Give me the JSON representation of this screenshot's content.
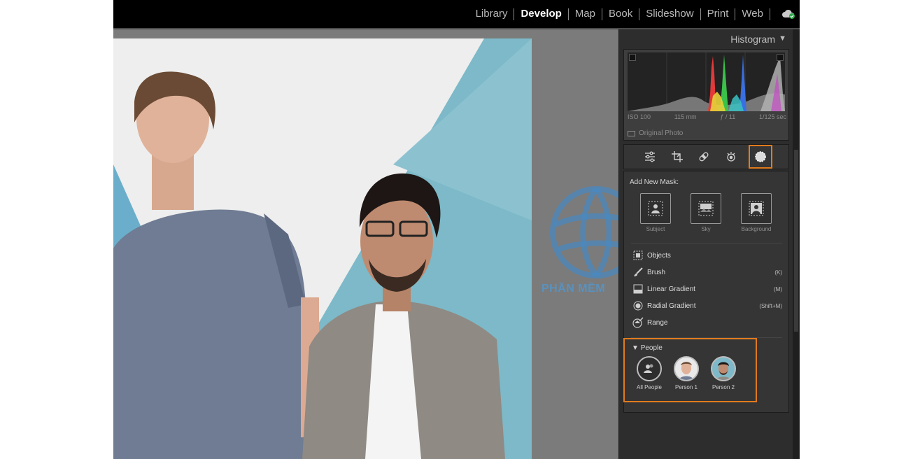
{
  "top_bar": {
    "modules": [
      {
        "label": "Library",
        "active": false
      },
      {
        "label": "Develop",
        "active": true
      },
      {
        "label": "Map",
        "active": false
      },
      {
        "label": "Book",
        "active": false
      },
      {
        "label": "Slideshow",
        "active": false
      },
      {
        "label": "Print",
        "active": false
      },
      {
        "label": "Web",
        "active": false
      }
    ],
    "cloud_icon": "cloud-sync-icon"
  },
  "histogram": {
    "title": "Histogram",
    "exif": {
      "iso": "ISO 100",
      "focal_length": "115 mm",
      "aperture": "ƒ / 11",
      "shutter": "1/125 sec"
    },
    "original_photo_label": "Original Photo"
  },
  "tools": [
    {
      "name": "edit-sliders-icon",
      "active": false
    },
    {
      "name": "crop-icon",
      "active": false
    },
    {
      "name": "healing-icon",
      "active": false
    },
    {
      "name": "red-eye-icon",
      "active": false
    },
    {
      "name": "masking-icon",
      "active": true
    }
  ],
  "masking": {
    "add_new_mask_label": "Add New Mask:",
    "quick_masks": [
      {
        "label": "Subject",
        "icon": "subject-icon"
      },
      {
        "label": "Sky",
        "icon": "sky-icon"
      },
      {
        "label": "Background",
        "icon": "background-icon"
      }
    ],
    "mask_tools": [
      {
        "label": "Objects",
        "shortcut": "",
        "icon": "objects-icon"
      },
      {
        "label": "Brush",
        "shortcut": "(K)",
        "icon": "brush-icon"
      },
      {
        "label": "Linear Gradient",
        "shortcut": "(M)",
        "icon": "linear-gradient-icon"
      },
      {
        "label": "Radial Gradient",
        "shortcut": "(Shift+M)",
        "icon": "radial-gradient-icon"
      },
      {
        "label": "Range",
        "shortcut": "",
        "icon": "range-icon"
      }
    ],
    "people": {
      "title": "People",
      "items": [
        {
          "label": "All People"
        },
        {
          "label": "Person 1"
        },
        {
          "label": "Person 2"
        }
      ]
    }
  },
  "watermark": {
    "text": "PHẦN MỀM"
  },
  "colors": {
    "accent": "#e07b1e",
    "panel": "#353535",
    "topbar": "#000000"
  }
}
